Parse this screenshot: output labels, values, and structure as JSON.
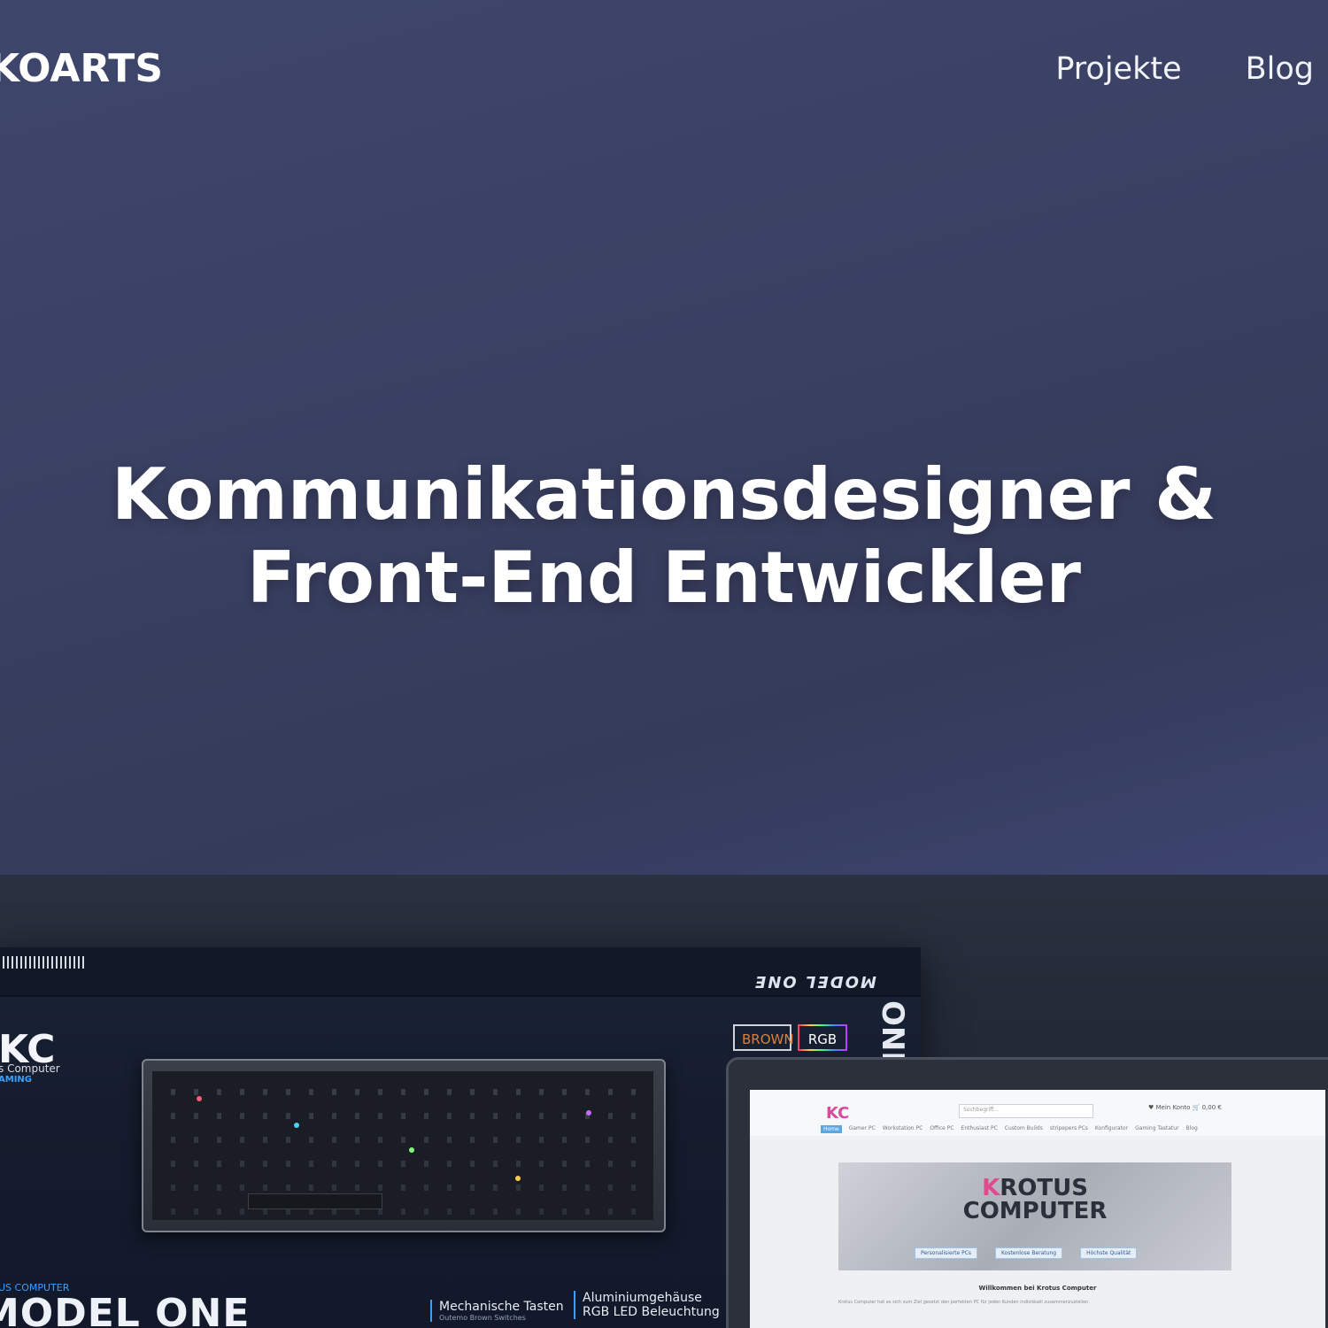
{
  "header": {
    "logo": "KOARTS",
    "nav": [
      {
        "label": "Projekte"
      },
      {
        "label": "Blog"
      }
    ]
  },
  "hero": {
    "line1": "Kommunikationsdesigner &",
    "line2": "Front-End Entwickler"
  },
  "showcase": {
    "box": {
      "lid_title": "MODEL ONE",
      "side_text": "ONE",
      "brand_mark": "KC",
      "brand_sub": "s Computer",
      "brand_gaming": "AMING",
      "tag_brown": "BROWN",
      "tag_rgb": "RGB",
      "foot_brand": "US COMPUTER",
      "foot_model": "MODEL ONE",
      "feature1_title": "Mechanische Tasten",
      "feature1_sub": "Outemo Brown Switches",
      "feature2_title": "Aluminiumgehäuse",
      "feature2_sub": "RGB LED Beleuchtung"
    },
    "website": {
      "logo": "KC",
      "search_placeholder": "Suchbegriff...",
      "icons_text": "♥  Mein Konto   🛒 0,00 €",
      "nav": [
        "Home",
        "Gamer PC",
        "Workstation PC",
        "Office PC",
        "Enthusiast PC",
        "Custom Builds",
        "stripepers PCs",
        "Konfigurator",
        "Gaming Tastatur",
        "Blog"
      ],
      "banner_k": "K",
      "banner_rest1": "ROTUS",
      "banner_line2": "COMPUTER",
      "badges": [
        "Personalisierte PCs",
        "Kostenlose Beratung",
        "Höchste Qualität"
      ],
      "welcome": "Willkommen bei Krotus Computer",
      "copy": "Krotus Computer hat es sich zum Ziel gesetzt den perfekten PC für jeden Kunden individuell zusammenzustellen."
    }
  },
  "colors": {
    "hero_bg": "#3a4063",
    "accent_blue": "#3aa0ff",
    "brown_tag": "#d7823c"
  }
}
